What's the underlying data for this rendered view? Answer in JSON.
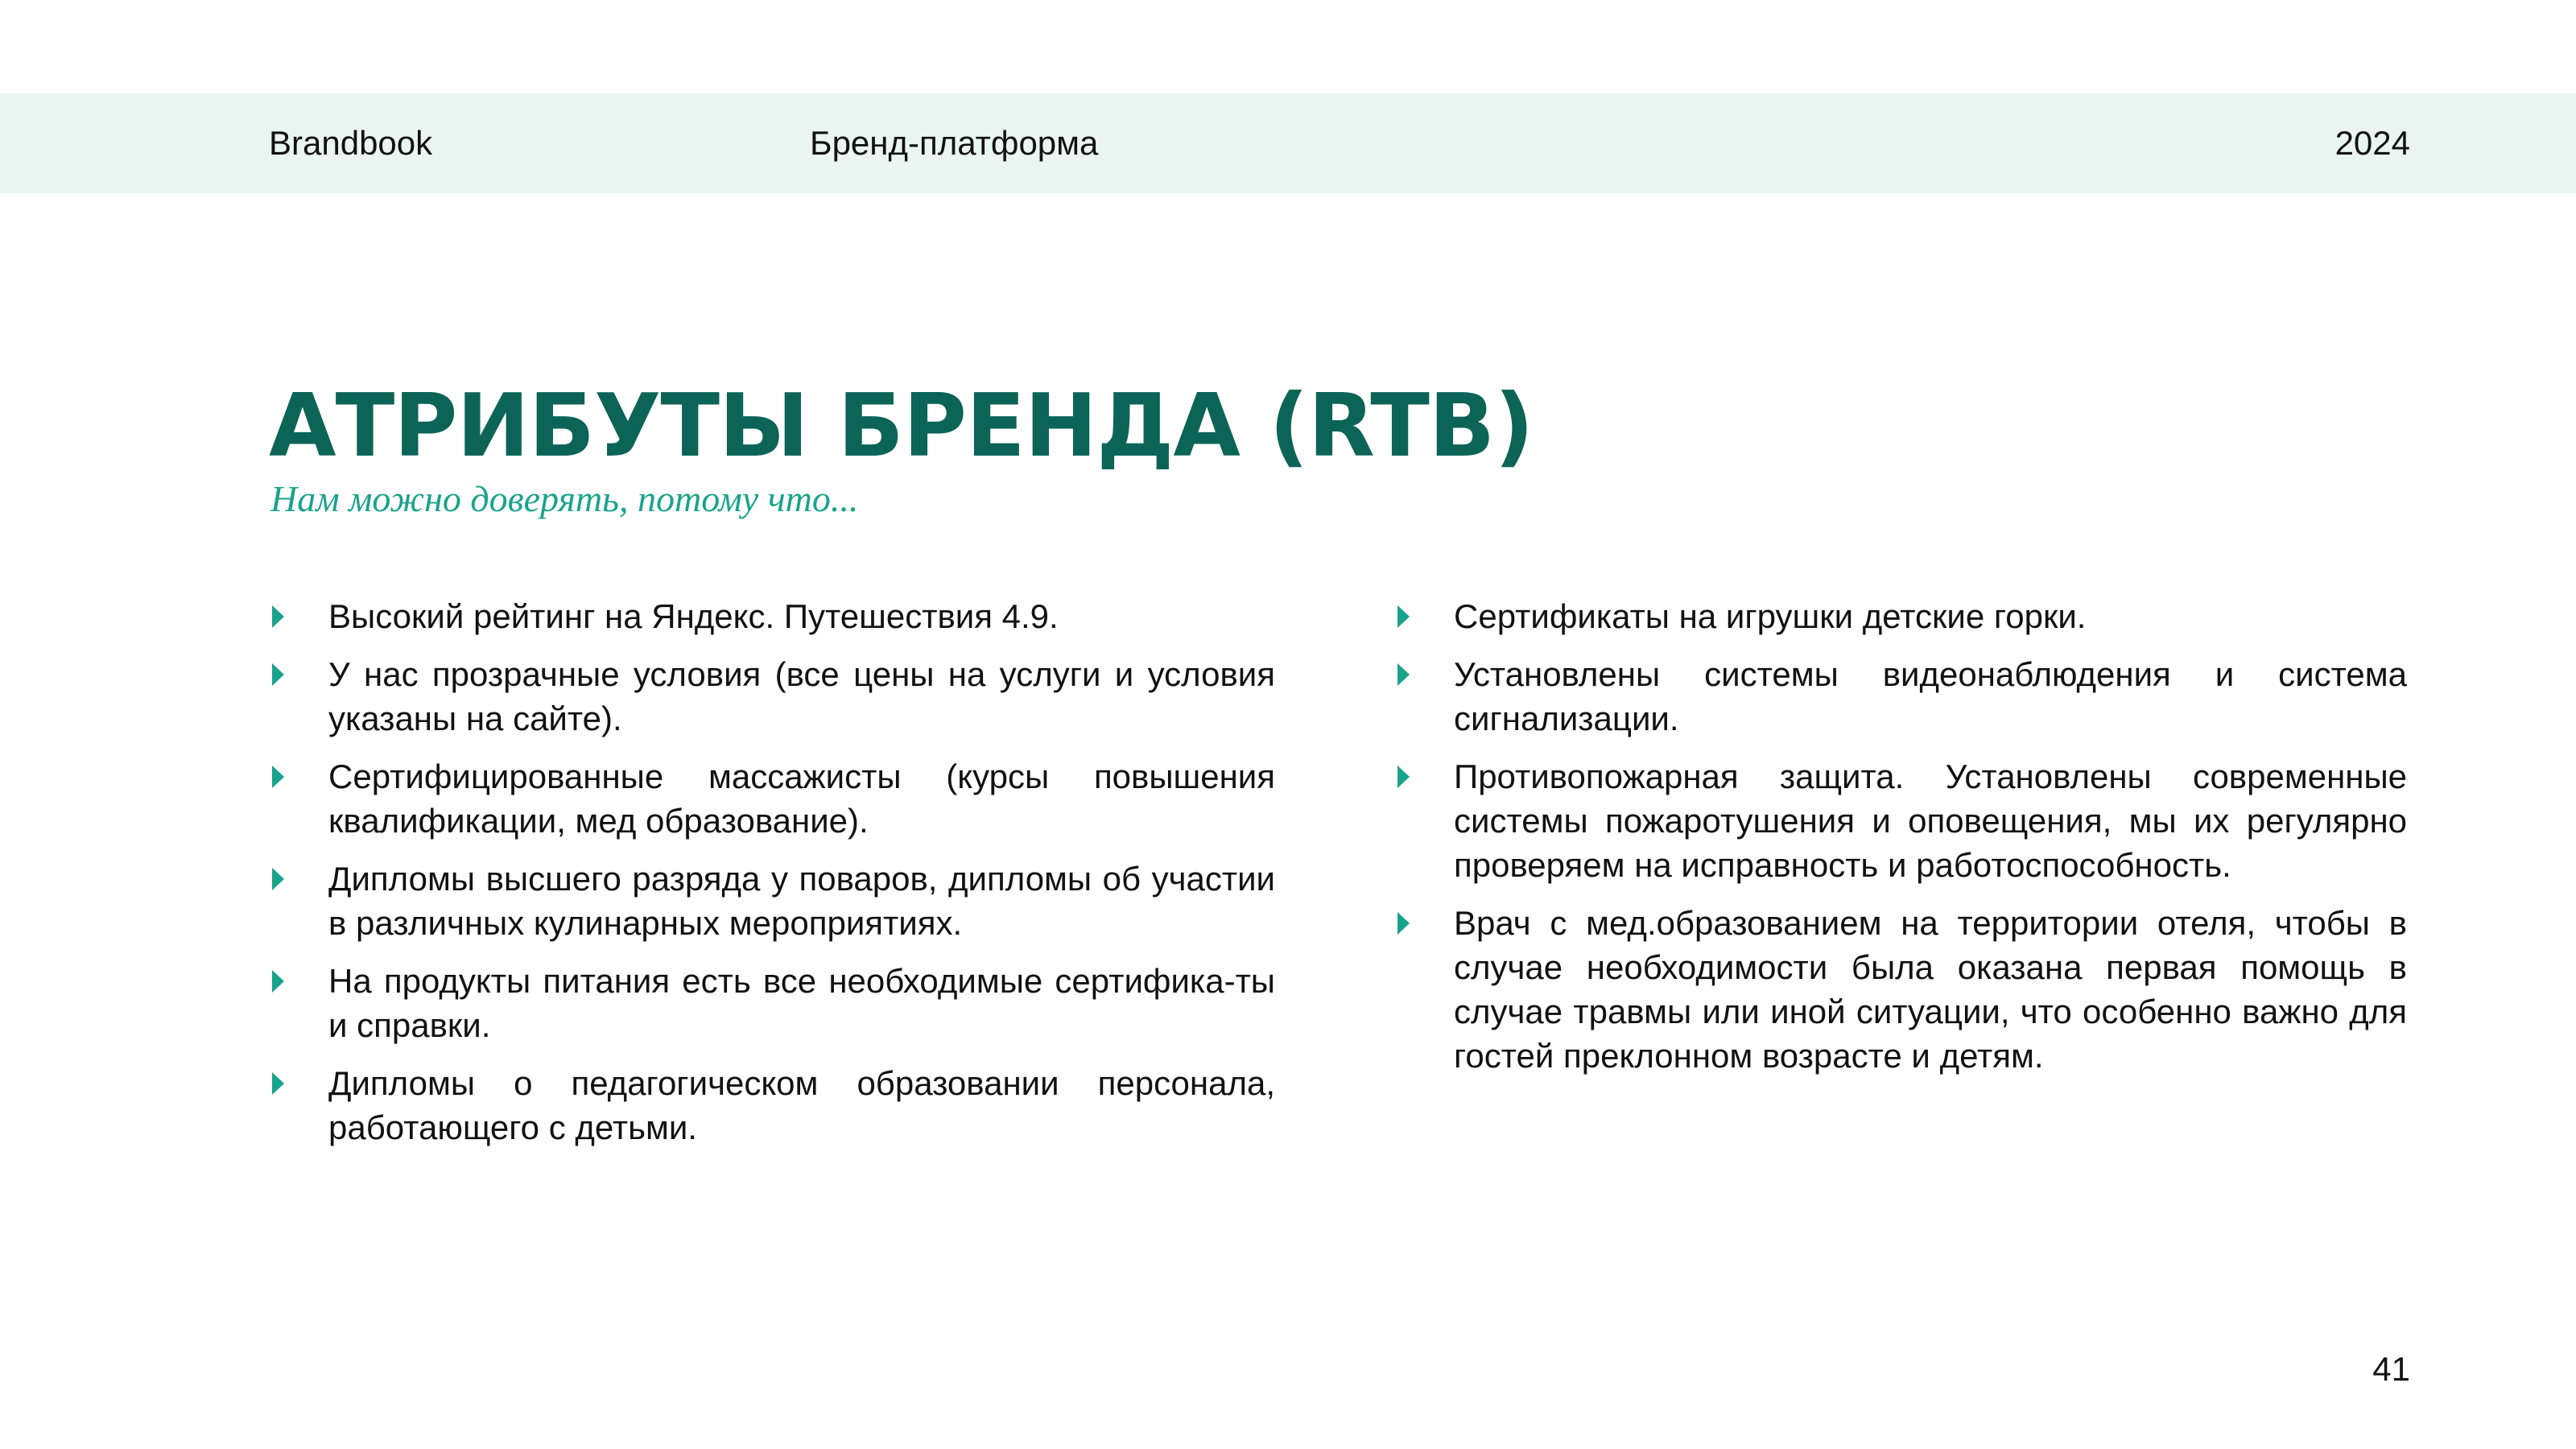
{
  "header": {
    "left": "Brandbook",
    "middle": "Бренд-платформа",
    "right": "2024"
  },
  "title": "АТРИБУТЫ БРЕНДА (RTB)",
  "subtitle": "Нам можно доверять, потому что...",
  "left_items": [
    "Высокий рейтинг на Яндекс. Путешествия 4.9.",
    "У нас прозрачные условия (все цены на услуги и условия указаны на сайте).",
    "Сертифицированные массажисты (курсы повышения квалификации, мед образование).",
    "Дипломы высшего разряда у поваров, дипломы об участии в различных кулинарных мероприятиях.",
    "На продукты питания есть все необходимые сертифика-ты и справки.",
    "Дипломы о педагогическом образовании персонала, работающего с детьми."
  ],
  "right_items": [
    "Сертификаты на игрушки детские горки.",
    "Установлены системы видеонаблюдения и система сигнализации.",
    "Противопожарная защита. Установлены современные системы пожаротушения и оповещения, мы их регулярно проверяем на исправность и работоспособность.",
    "Врач с мед.образованием на территории отеля, чтобы в случае необходимости была оказана первая помощь в случае травмы или иной ситуации, что особенно важно для гостей преклонном возрасте и детям."
  ],
  "page_number": "41",
  "colors": {
    "header_band": "#eaf5f1",
    "title": "#0c6457",
    "accent": "#1aa38b",
    "text": "#111111"
  }
}
